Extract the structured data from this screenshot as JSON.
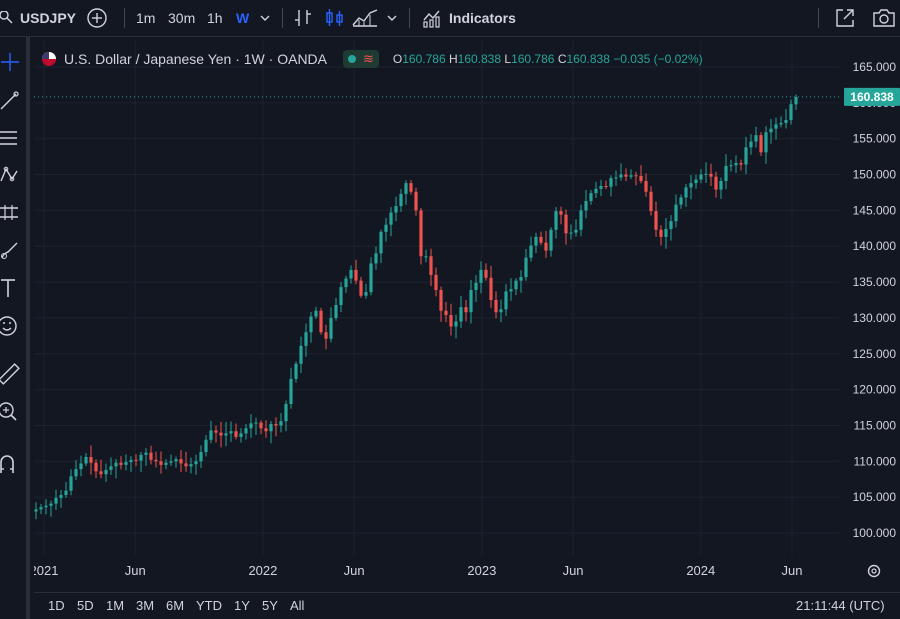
{
  "toolbar": {
    "symbol": "USDJPY",
    "intervals": [
      "1m",
      "30m",
      "1h",
      "W"
    ],
    "indicators_label": "Indicators"
  },
  "legend": {
    "title": "U.S. Dollar / Japanese Yen · 1W · OANDA",
    "open_label": "O",
    "open": "160.786",
    "high_label": "H",
    "high": "160.838",
    "low_label": "L",
    "low": "160.786",
    "close_label": "C",
    "close": "160.838",
    "change": "−0.035 (−0.02%)"
  },
  "price_axis": {
    "labels": [
      "165.000",
      "160.000",
      "155.000",
      "150.000",
      "145.000",
      "140.000",
      "135.000",
      "130.000",
      "125.000",
      "120.000",
      "115.000",
      "110.000",
      "105.000",
      "100.000"
    ],
    "current_price": "160.838"
  },
  "time_axis": {
    "labels": [
      "2021",
      "Jun",
      "2022",
      "Jun",
      "2023",
      "Jun",
      "2024",
      "Jun"
    ]
  },
  "ranges": [
    "1D",
    "5D",
    "1M",
    "3M",
    "6M",
    "YTD",
    "1Y",
    "5Y",
    "All"
  ],
  "clock": "21:11:44 (UTC)",
  "colors": {
    "up": "#26a69a",
    "down": "#ef5350",
    "bg": "#131722",
    "grid": "#1e222d",
    "accent": "#2962ff"
  },
  "chart_data": {
    "type": "candlestick",
    "title": "U.S. Dollar / Japanese Yen · 1W · OANDA",
    "ylim": [
      98,
      167
    ],
    "x_start": "2021-01",
    "x_end": "2024-07",
    "close": [
      103.3,
      103.6,
      103.8,
      104.1,
      104.9,
      105.3,
      105.9,
      107.9,
      108.9,
      109.7,
      110.6,
      109.8,
      108.6,
      108.2,
      108.8,
      109.3,
      109.8,
      109.5,
      109.9,
      110.2,
      110.1,
      110.9,
      111.2,
      110.2,
      110.0,
      109.5,
      109.8,
      110.0,
      110.3,
      109.7,
      109.3,
      109.6,
      110.0,
      111.3,
      113.0,
      114.3,
      114.0,
      113.6,
      113.9,
      114.2,
      113.4,
      113.9,
      114.6,
      115.3,
      115.4,
      114.6,
      114.2,
      115.2,
      115.0,
      115.6,
      118.0,
      121.5,
      123.6,
      126.1,
      128.0,
      130.2,
      131.0,
      128.0,
      127.1,
      130.0,
      131.8,
      134.3,
      135.5,
      136.7,
      135.2,
      133.1,
      133.6,
      137.6,
      139.0,
      142.0,
      143.0,
      144.7,
      145.6,
      147.3,
      148.8,
      147.6,
      145.0,
      138.6,
      138.6,
      136.0,
      133.9,
      131.0,
      130.4,
      128.8,
      129.5,
      131.5,
      130.8,
      133.9,
      134.9,
      136.7,
      135.6,
      132.5,
      130.8,
      131.2,
      133.7,
      134.0,
      135.2,
      135.7,
      138.4,
      140.1,
      141.3,
      140.5,
      139.4,
      142.3,
      144.9,
      144.4,
      141.8,
      141.9,
      142.3,
      145.0,
      146.3,
      147.4,
      148.0,
      148.4,
      148.3,
      149.5,
      149.6,
      150.0,
      149.7,
      149.9,
      149.8,
      149.1,
      147.6,
      144.9,
      142.3,
      141.3,
      142.4,
      143.5,
      145.8,
      146.8,
      148.2,
      148.8,
      149.3,
      150.0,
      150.1,
      149.7,
      147.9,
      149.1,
      151.2,
      151.3,
      151.6,
      151.4,
      153.8,
      154.6,
      155.5,
      153.1,
      155.9,
      156.4,
      157.0,
      157.2,
      157.6,
      159.8,
      160.8
    ]
  }
}
